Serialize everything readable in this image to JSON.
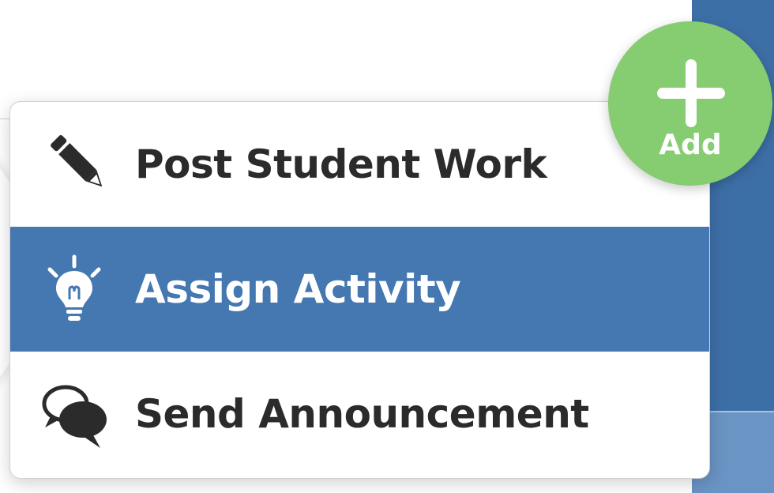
{
  "menu": {
    "items": [
      {
        "label": "Post Student Work",
        "icon": "pencil-icon"
      },
      {
        "label": "Assign Activity",
        "icon": "lightbulb-icon",
        "highlighted": true
      },
      {
        "label": "Send Announcement",
        "icon": "speech-bubbles-icon"
      }
    ]
  },
  "add_button": {
    "label": "Add",
    "icon": "plus-icon"
  },
  "colors": {
    "highlight": "#4577b0",
    "add_button": "#86cc71",
    "text": "#2b2b2b",
    "background_panel": "#3d6fa7"
  }
}
